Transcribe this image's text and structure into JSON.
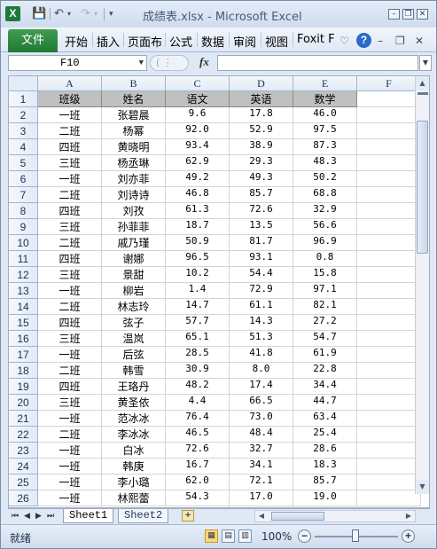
{
  "window": {
    "title": "成绩表.xlsx - Microsoft Excel",
    "app_icon_letter": "X",
    "accent_color": "#217a35"
  },
  "ribbon": {
    "file_label": "文件",
    "tabs": [
      "开始",
      "插入",
      "页面布",
      "公式",
      "数据",
      "审阅",
      "视图",
      "Foxit F"
    ]
  },
  "formula_bar": {
    "name_box": "F10",
    "fx_label": "fx",
    "formula": ""
  },
  "sheet": {
    "columns": [
      "A",
      "B",
      "C",
      "D",
      "E",
      "F"
    ],
    "rows": [
      [
        "1",
        "班级",
        "姓名",
        "语文",
        "英语",
        "数学",
        ""
      ],
      [
        "2",
        "一班",
        "张碧晨",
        "9.6",
        "17.8",
        "46.0",
        ""
      ],
      [
        "3",
        "二班",
        "杨幂",
        "92.0",
        "52.9",
        "97.5",
        ""
      ],
      [
        "4",
        "四班",
        "黄晓明",
        "93.4",
        "38.9",
        "87.3",
        ""
      ],
      [
        "5",
        "三班",
        "杨丞琳",
        "62.9",
        "29.3",
        "48.3",
        ""
      ],
      [
        "6",
        "一班",
        "刘亦菲",
        "49.2",
        "49.3",
        "50.2",
        ""
      ],
      [
        "7",
        "二班",
        "刘诗诗",
        "46.8",
        "85.7",
        "68.8",
        ""
      ],
      [
        "8",
        "四班",
        "刘孜",
        "61.3",
        "72.6",
        "32.9",
        ""
      ],
      [
        "9",
        "三班",
        "孙菲菲",
        "18.7",
        "13.5",
        "56.6",
        ""
      ],
      [
        "10",
        "二班",
        "戚乃瑾",
        "50.9",
        "81.7",
        "96.9",
        ""
      ],
      [
        "11",
        "四班",
        "谢娜",
        "96.5",
        "93.1",
        "0.8",
        ""
      ],
      [
        "12",
        "三班",
        "景甜",
        "10.2",
        "54.4",
        "15.8",
        ""
      ],
      [
        "13",
        "一班",
        "柳岩",
        "1.4",
        "72.9",
        "97.1",
        ""
      ],
      [
        "14",
        "二班",
        "林志玲",
        "14.7",
        "61.1",
        "82.1",
        ""
      ],
      [
        "15",
        "四班",
        "弦子",
        "57.7",
        "14.3",
        "27.2",
        ""
      ],
      [
        "16",
        "三班",
        "温岚",
        "65.1",
        "51.3",
        "54.7",
        ""
      ],
      [
        "17",
        "一班",
        "后弦",
        "28.5",
        "41.8",
        "61.9",
        ""
      ],
      [
        "18",
        "二班",
        "韩雪",
        "30.9",
        "8.0",
        "22.8",
        ""
      ],
      [
        "19",
        "四班",
        "王珞丹",
        "48.2",
        "17.4",
        "34.4",
        ""
      ],
      [
        "20",
        "三班",
        "黄圣依",
        "4.4",
        "66.5",
        "44.7",
        ""
      ],
      [
        "21",
        "一班",
        "范冰冰",
        "76.4",
        "73.0",
        "63.4",
        ""
      ],
      [
        "22",
        "二班",
        "李冰冰",
        "46.5",
        "48.4",
        "25.4",
        ""
      ],
      [
        "23",
        "一班",
        "白冰",
        "72.6",
        "32.7",
        "28.6",
        ""
      ],
      [
        "24",
        "一班",
        "韩庚",
        "16.7",
        "34.1",
        "18.3",
        ""
      ],
      [
        "25",
        "一班",
        "李小璐",
        "62.0",
        "72.1",
        "85.7",
        ""
      ],
      [
        "26",
        "一班",
        "林熙蕾",
        "54.3",
        "17.0",
        "19.0",
        ""
      ]
    ],
    "header_fill": "#c0c0c0",
    "gridline_color": "#d4d4d4"
  },
  "sheet_tabs": [
    "Sheet1",
    "Sheet2"
  ],
  "status": {
    "text": "就绪",
    "zoom": "100%"
  }
}
